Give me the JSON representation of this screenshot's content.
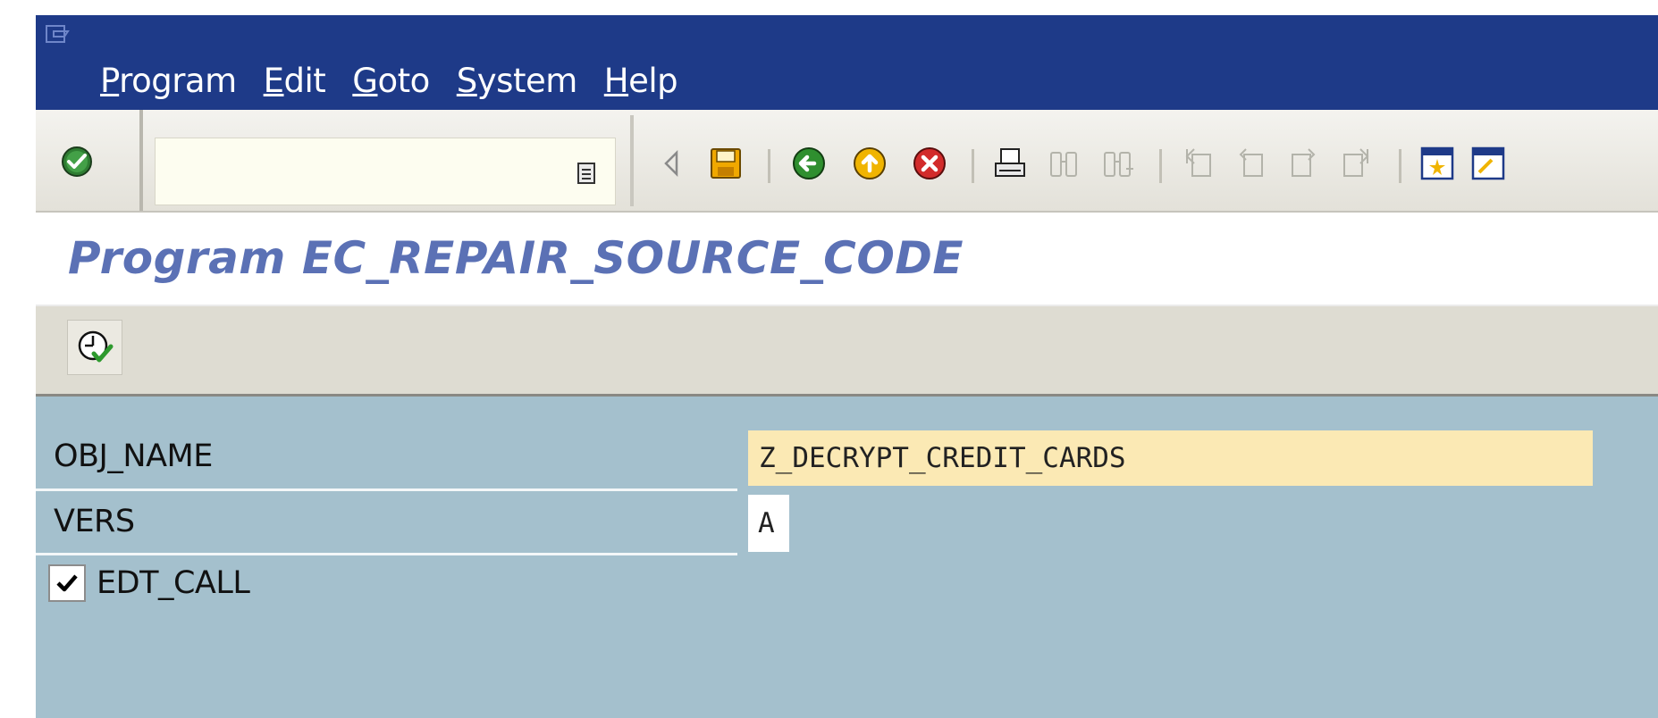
{
  "menu": [
    {
      "label": "Program"
    },
    {
      "label": "Edit"
    },
    {
      "label": "Goto"
    },
    {
      "label": "System"
    },
    {
      "label": "Help"
    }
  ],
  "command_field": {
    "value": ""
  },
  "toolbar_icons": [
    "back-arrow-icon",
    "save-icon",
    "back-icon",
    "exit-icon",
    "cancel-icon",
    "print-icon",
    "find-icon",
    "find-next-icon",
    "first-page-icon",
    "previous-page-icon",
    "next-page-icon",
    "last-page-icon",
    "create-session-icon"
  ],
  "title": "Program EC_REPAIR_SOURCE_CODE",
  "app_toolbar": {
    "execute_icon": "execute-icon"
  },
  "form": {
    "obj_name_label": "OBJ_NAME",
    "obj_name_value": "Z_DECRYPT_CREDIT_CARDS",
    "vers_label": "VERS",
    "vers_value": "A",
    "edt_call_label": "EDT_CALL",
    "edt_call_checked": true
  },
  "colors": {
    "menubar": "#1e3a88",
    "title": "#5b71b5",
    "form_background": "#a4c0cd",
    "required_field": "#fbe9b4"
  }
}
